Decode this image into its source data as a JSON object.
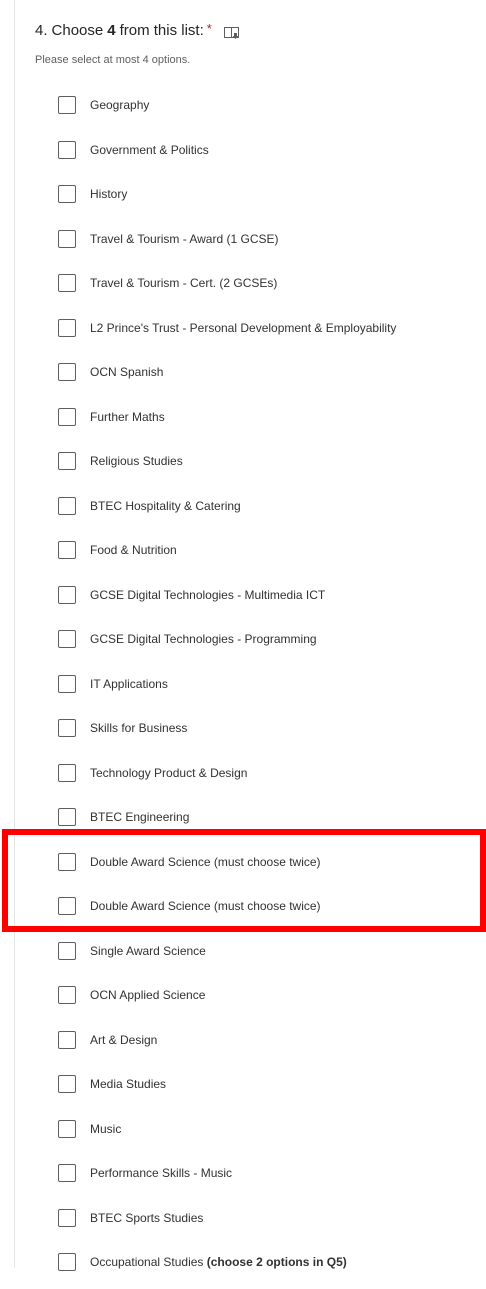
{
  "question": {
    "number": "4.",
    "prefix": "Choose",
    "bold_count": "4",
    "suffix": "from this list:",
    "required_mark": "*",
    "hint": "Please select at most 4 options."
  },
  "icons": {
    "immersive_reader": "immersive-reader-icon"
  },
  "colors": {
    "highlight": "#ff0000",
    "required": "#a4262c"
  },
  "options": [
    {
      "label": "Geography"
    },
    {
      "label": "Government & Politics"
    },
    {
      "label": "History"
    },
    {
      "label": "Travel & Tourism - Award (1 GCSE)"
    },
    {
      "label": "Travel & Tourism - Cert. (2 GCSEs)"
    },
    {
      "label": "L2 Prince's Trust - Personal Development & Employability"
    },
    {
      "label": "OCN Spanish"
    },
    {
      "label": "Further Maths"
    },
    {
      "label": "Religious Studies"
    },
    {
      "label": "BTEC Hospitality & Catering"
    },
    {
      "label": "Food & Nutrition"
    },
    {
      "label": "GCSE Digital Technologies - Multimedia ICT"
    },
    {
      "label": "GCSE Digital Technologies - Programming"
    },
    {
      "label": "IT Applications"
    },
    {
      "label": "Skills for Business"
    },
    {
      "label": "Technology Product & Design"
    },
    {
      "label": "BTEC Engineering"
    },
    {
      "label": "Double Award Science (must choose twice)"
    },
    {
      "label": "Double Award Science (must choose twice)"
    },
    {
      "label": "Single Award Science"
    },
    {
      "label": "OCN Applied Science"
    },
    {
      "label": "Art & Design"
    },
    {
      "label": "Media Studies"
    },
    {
      "label": "Music"
    },
    {
      "label": "Performance Skills - Music"
    },
    {
      "label": "BTEC Sports Studies"
    },
    {
      "label": "Occupational Studies",
      "bold_suffix": "(choose 2 options in Q5)"
    }
  ]
}
